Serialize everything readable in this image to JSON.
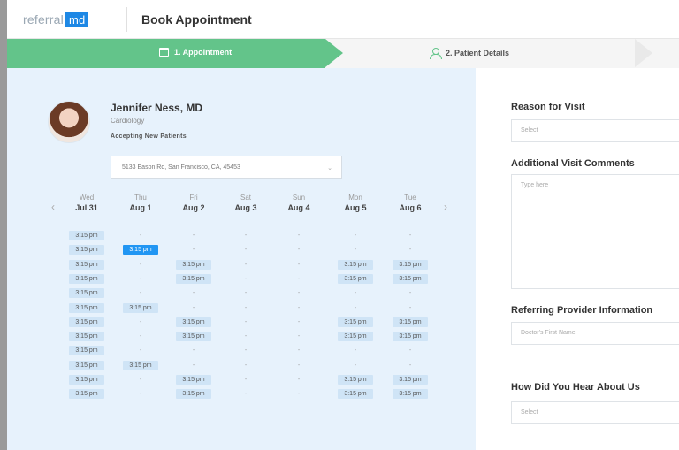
{
  "header": {
    "logo_text": "referral",
    "logo_badge": "md",
    "title": "Book Appointment"
  },
  "steps": [
    {
      "label": "1. Appointment",
      "state": "active",
      "icon": "calendar-icon"
    },
    {
      "label": "2. Patient Details",
      "state": "inactive",
      "icon": "user-icon"
    }
  ],
  "doctor": {
    "name": "Jennifer Ness, MD",
    "specialty": "Cardiology",
    "status": "Accepting New Patients"
  },
  "location": {
    "selected": "5133 Eason Rd, San Francisco, CA, 45453"
  },
  "calendar": {
    "prev_icon": "‹",
    "next_icon": "›",
    "days": [
      {
        "dow": "Wed",
        "date": "Jul 31"
      },
      {
        "dow": "Thu",
        "date": "Aug 1"
      },
      {
        "dow": "Fri",
        "date": "Aug 2"
      },
      {
        "dow": "Sat",
        "date": "Aug 3"
      },
      {
        "dow": "Sun",
        "date": "Aug 4"
      },
      {
        "dow": "Mon",
        "date": "Aug 5"
      },
      {
        "dow": "Tue",
        "date": "Aug 6"
      }
    ],
    "slot_rows": [
      [
        "3:15 pm",
        "-",
        "-",
        "-",
        "-",
        "-",
        "-"
      ],
      [
        "3:15 pm",
        "3:15 pm",
        "-",
        "-",
        "-",
        "-",
        "-"
      ],
      [
        "3:15 pm",
        "-",
        "3:15 pm",
        "-",
        "-",
        "3:15 pm",
        "3:15 pm"
      ],
      [
        "3:15 pm",
        "-",
        "3:15 pm",
        "-",
        "-",
        "3:15 pm",
        "3:15 pm"
      ],
      [
        "3:15 pm",
        "-",
        "-",
        "-",
        "-",
        "-",
        "-"
      ],
      [
        "3:15 pm",
        "3:15 pm",
        "-",
        "-",
        "-",
        "-",
        "-"
      ],
      [
        "3:15 pm",
        "-",
        "3:15 pm",
        "-",
        "-",
        "3:15 pm",
        "3:15 pm"
      ],
      [
        "3:15 pm",
        "-",
        "3:15 pm",
        "-",
        "-",
        "3:15 pm",
        "3:15 pm"
      ],
      [
        "3:15 pm",
        "-",
        "-",
        "-",
        "-",
        "-",
        "-"
      ],
      [
        "3:15 pm",
        "3:15 pm",
        "-",
        "-",
        "-",
        "-",
        "-"
      ],
      [
        "3:15 pm",
        "-",
        "3:15 pm",
        "-",
        "-",
        "3:15 pm",
        "3:15 pm"
      ],
      [
        "3:15 pm",
        "-",
        "3:15 pm",
        "-",
        "-",
        "3:15 pm",
        "3:15 pm"
      ]
    ],
    "selected_slot": {
      "row": 1,
      "col": 1
    }
  },
  "form": {
    "reason_label": "Reason for Visit",
    "reason_placeholder": "Select",
    "comments_label": "Additional Visit Comments",
    "comments_placeholder": "Type here",
    "referring_label": "Referring Provider Information",
    "referring_placeholder": "Doctor's First Name",
    "hear_label": "How Did You Hear About Us",
    "hear_placeholder": "Select"
  },
  "colors": {
    "step_active": "#63c48a",
    "calendar_bg": "#e7f2fc",
    "slot_available": "#cfe4f6",
    "slot_selected": "#2196f3",
    "logo_badge": "#1e88e5"
  }
}
